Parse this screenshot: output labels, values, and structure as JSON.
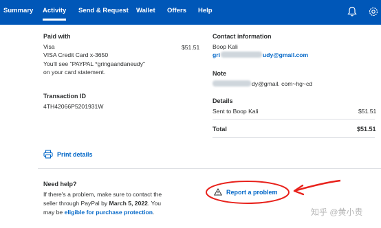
{
  "nav": {
    "items": [
      {
        "label": "Summary"
      },
      {
        "label": "Activity"
      },
      {
        "label": "Send & Request"
      },
      {
        "label": "Wallet"
      },
      {
        "label": "Offers"
      },
      {
        "label": "Help"
      }
    ],
    "active": "Activity",
    "icons": [
      "bell-icon",
      "gear-icon"
    ],
    "color": "#0057b8"
  },
  "paid_with": {
    "label": "Paid with",
    "method": "Visa",
    "card": "VISA Credit Card x-3650",
    "statement_line1": "You'll see \"PAYPAL *gringaandaneudy\"",
    "statement_line2": "on your card statement.",
    "amount": "$51.51"
  },
  "transaction": {
    "label": "Transaction ID",
    "id": "4TH42066P520193​1W"
  },
  "contact": {
    "label": "Contact information",
    "name": "Boop Kali",
    "email_prefix": "gri",
    "email_suffix": "udy@gmail.com"
  },
  "note": {
    "label": "Note",
    "text_suffix": "dy@gmail. com~hg~cd"
  },
  "details": {
    "label": "Details",
    "row_label": "Sent to Boop Kali",
    "row_amount": "$51.51",
    "total_label": "Total",
    "total_amount": "$51.51"
  },
  "print": {
    "label": "Print details"
  },
  "help": {
    "title": "Need help?",
    "text1": "If there's a problem, make sure to contact the",
    "text2_prefix": "seller through PayPal by ",
    "deadline": "March 5, 2022",
    "text2_suffix": ". You",
    "text3_prefix": "may be ",
    "protection_link": "eligible for purchase protection",
    "text3_suffix": "."
  },
  "report": {
    "label": "Report a problem"
  },
  "annotation_color": "#e8221c",
  "watermark": "知乎 @黄小贵"
}
